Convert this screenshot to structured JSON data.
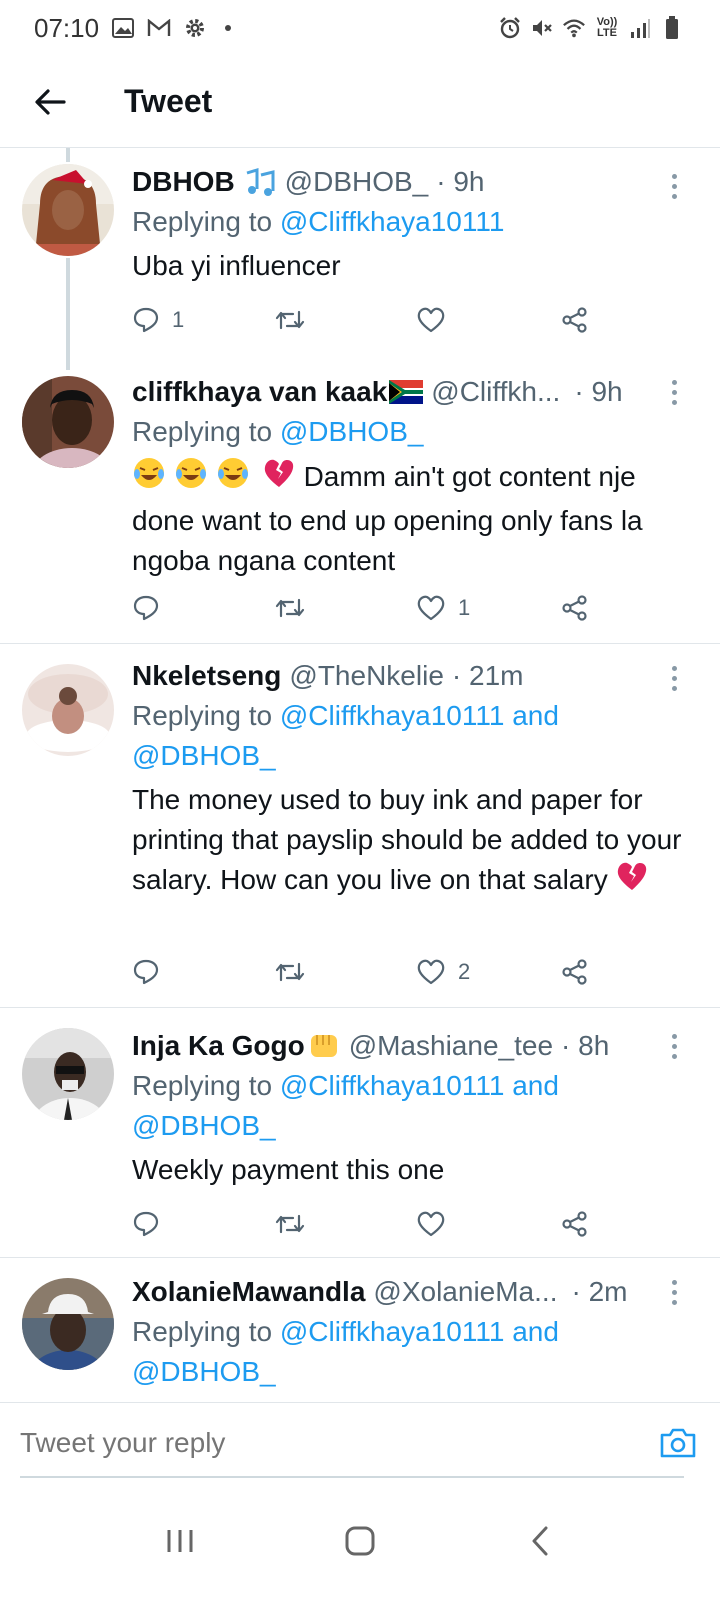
{
  "status_bar": {
    "time": "07:10",
    "volte": "Vo)) LTE"
  },
  "header": {
    "title": "Tweet"
  },
  "tweets": [
    {
      "name": "DBHOB",
      "handle": "@DBHOB_",
      "time": "· 9h",
      "replying_label": "Replying to",
      "replying_to": "@Cliffkhaya10111",
      "body": "Uba yi influencer",
      "replies": "1",
      "retweets": "",
      "likes": ""
    },
    {
      "name": "cliffkhaya van kaak",
      "handle": "@Cliffkh...",
      "time": "· 9h",
      "replying_label": "Replying to",
      "replying_to": "@DBHOB_",
      "body": "Damm ain't got content nje done want to end up opening only fans la ngoba ngana content",
      "replies": "",
      "retweets": "",
      "likes": "1"
    },
    {
      "name": "Nkeletseng",
      "handle": "@TheNkelie",
      "time": "· 21m",
      "replying_label": "Replying to",
      "replying_to": "@Cliffkhaya10111 and @DBHOB_",
      "body": "The money used to buy ink and paper for printing that payslip should be added to your salary. How can you live on that salary",
      "replies": "",
      "retweets": "",
      "likes": "2"
    },
    {
      "name": "Inja Ka Gogo",
      "handle": "@Mashiane_tee",
      "time": "· 8h",
      "replying_label": "Replying to",
      "replying_to": "@Cliffkhaya10111 and @DBHOB_",
      "body": "Weekly payment this one",
      "replies": "",
      "retweets": "",
      "likes": ""
    },
    {
      "name": "XolanieMawandla",
      "handle": "@XolanieMa...",
      "time": "· 2m",
      "replying_label": "Replying to",
      "replying_to": "@Cliffkhaya10111 and @DBHOB_"
    }
  ],
  "reply_bar": {
    "placeholder": "Tweet your reply"
  },
  "colors": {
    "accent": "#1d9bf0",
    "text": "#0f1419",
    "muted": "#536471",
    "heart_broken": "#e0245e"
  }
}
